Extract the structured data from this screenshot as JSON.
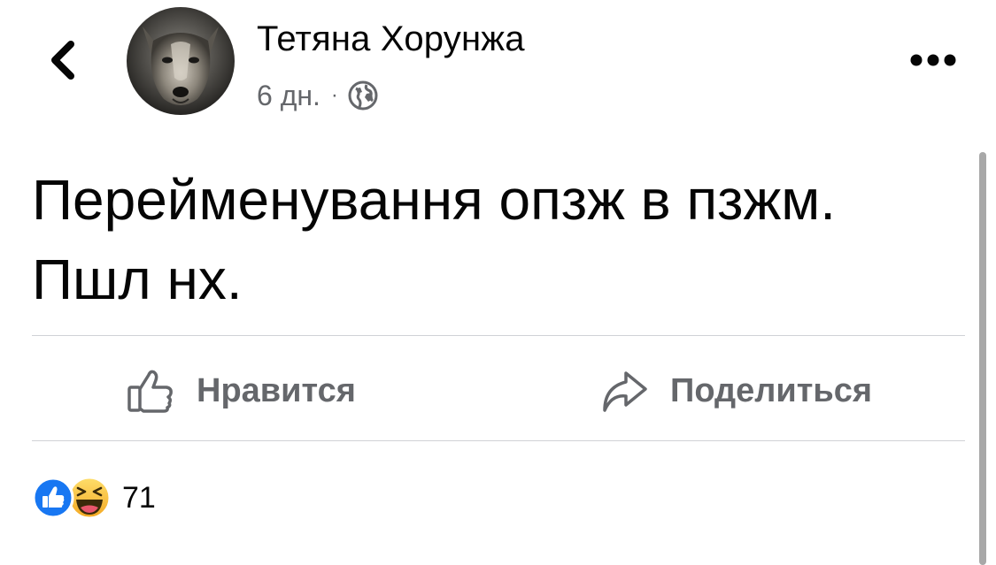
{
  "header": {
    "back_icon": "chevron-left-icon",
    "author_name": "Тетяна Хорунжа",
    "time": "6 дн.",
    "separator": "·",
    "privacy_icon": "globe-icon",
    "more_icon": "more-horizontal-icon"
  },
  "post": {
    "text": "Перейменування опзж в пзжм. Пшл нх."
  },
  "actions": {
    "like_icon": "thumbs-up-icon",
    "like_label": "Нравится",
    "share_icon": "share-arrow-icon",
    "share_label": "Поделиться"
  },
  "reactions": {
    "icons": [
      "like-reaction-icon",
      "haha-reaction-icon"
    ],
    "count": "71"
  },
  "colors": {
    "text_primary": "#050505",
    "text_secondary": "#65676b",
    "like_blue": "#1877f2",
    "haha_yellow": "#f7b125",
    "divider": "#d0d2d6"
  }
}
